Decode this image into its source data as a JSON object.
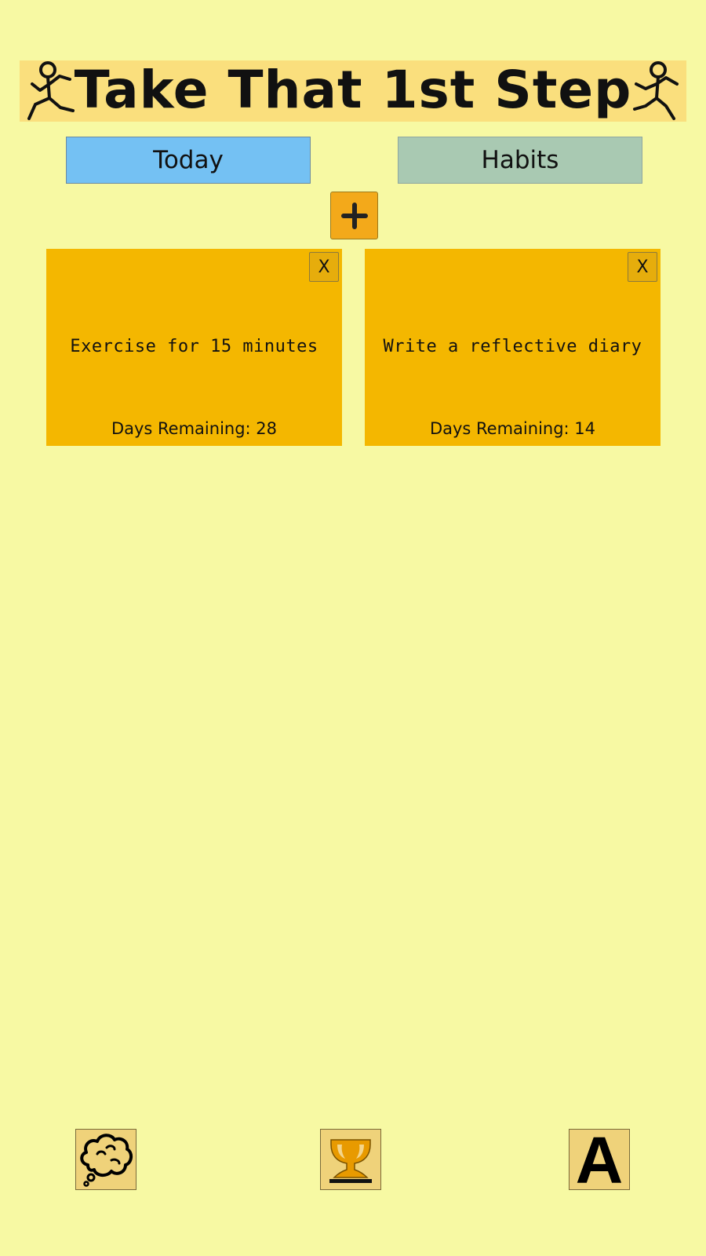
{
  "header": {
    "title": "Take That 1st Step",
    "left_icon": "stick-figure-icon",
    "right_icon": "stick-figure-icon"
  },
  "tabs": [
    {
      "label": "Today",
      "color": "#74c1f3"
    },
    {
      "label": "Habits",
      "color": "#a9c9b2"
    }
  ],
  "add_button": {
    "icon": "plus-icon",
    "color": "#f3a91a"
  },
  "cards": [
    {
      "text": "Exercise for 15 minutes",
      "days_remaining": "Days Remaining: 28",
      "close": "X"
    },
    {
      "text": "Write a reflective diary",
      "days_remaining": "Days Remaining: 14",
      "close": "X"
    }
  ],
  "bottom_bar": {
    "items": [
      {
        "icon": "thought-bubble-icon"
      },
      {
        "icon": "trophy-icon"
      },
      {
        "icon": "font-a-icon",
        "glyph": "A"
      }
    ]
  },
  "colors": {
    "background": "#f7f9a3",
    "header": "#fadf7d",
    "card": "#f4b700"
  }
}
